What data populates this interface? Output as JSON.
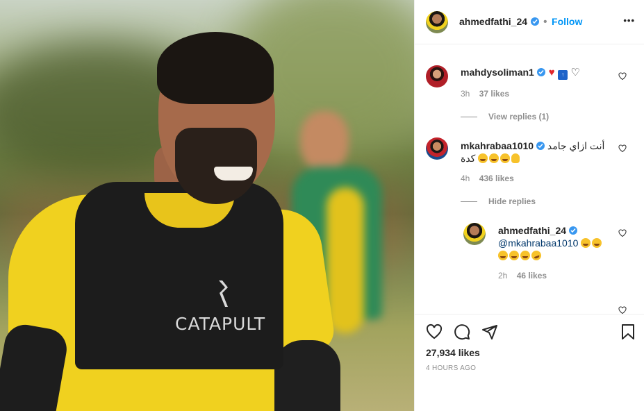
{
  "post": {
    "image_text": "CATAPULT",
    "owner": "ahmedfathi_24",
    "follow_label": "Follow",
    "more_label": "•••"
  },
  "comments": [
    {
      "username": "mahdysoliman1",
      "text": "",
      "age": "3h",
      "likes": "37 likes",
      "view_replies": "View replies (1)"
    },
    {
      "username": "mkahrabaa1010",
      "text_line1": "أنت ازاي جامد",
      "text_line2": "كدة",
      "age": "4h",
      "likes": "436 likes",
      "hide_replies": "Hide replies"
    }
  ],
  "reply": {
    "username": "ahmedfathi_24",
    "mention": "@mkahrabaa1010",
    "age": "2h",
    "likes": "46 likes"
  },
  "footer": {
    "likes": "27,934 likes",
    "time": "4 HOURS AGO"
  },
  "icons": [
    "heart-icon",
    "comment-icon",
    "share-icon",
    "bookmark-icon",
    "more-options-icon",
    "verified-icon"
  ],
  "colors": {
    "link_blue": "#0095f6",
    "verified_blue": "#3897f0",
    "muted": "#8e8e8e"
  }
}
